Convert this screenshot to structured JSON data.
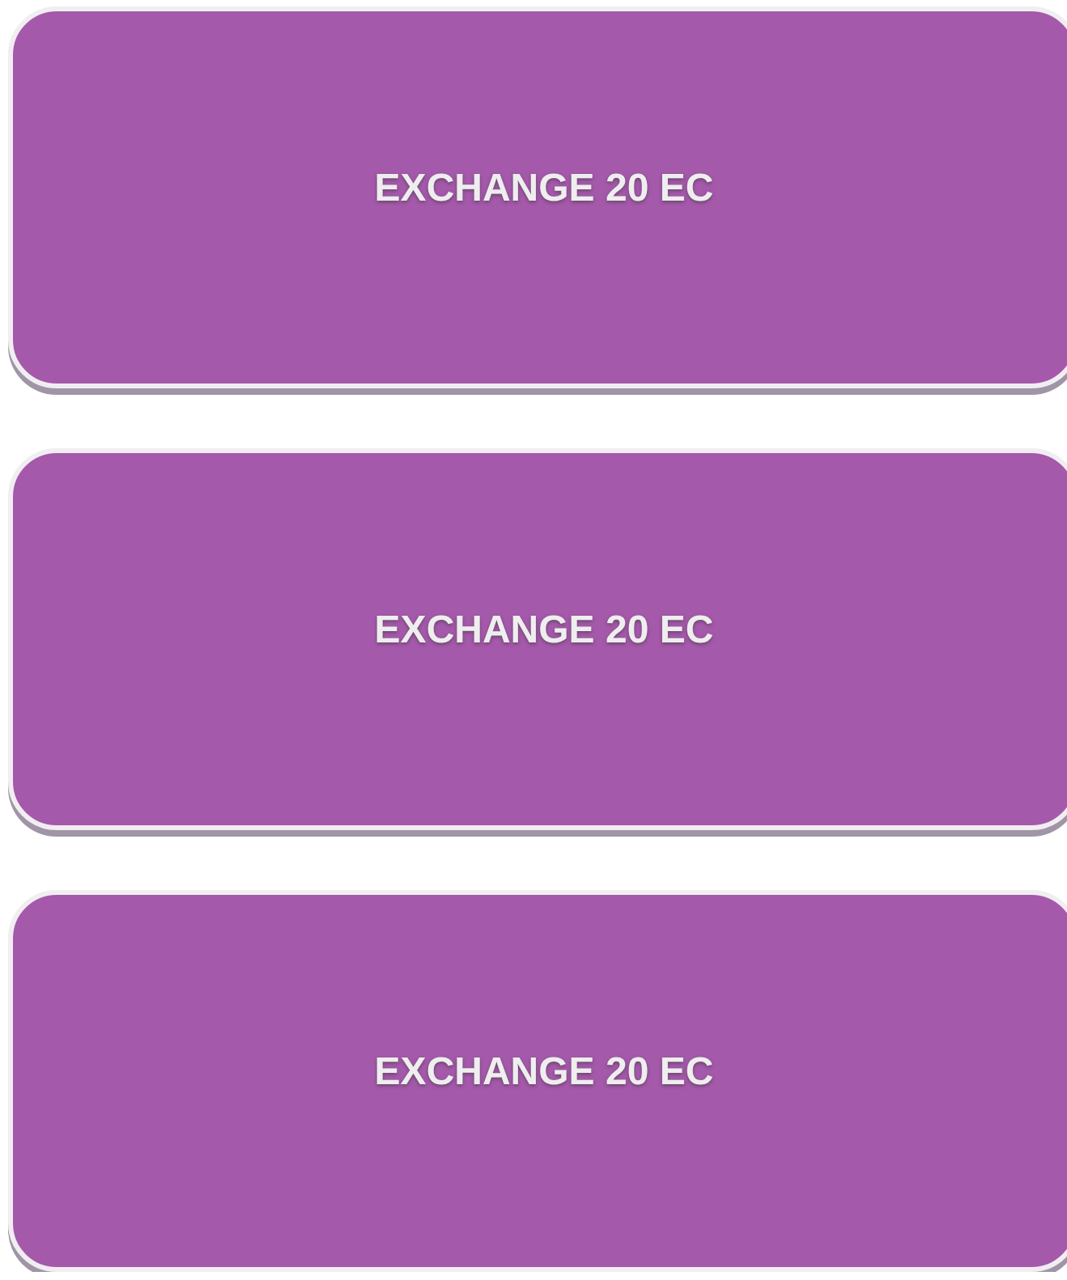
{
  "buttons": [
    {
      "label": "EXCHANGE 20 EC"
    },
    {
      "label": "EXCHANGE 20 EC"
    },
    {
      "label": "EXCHANGE 20 EC"
    }
  ]
}
